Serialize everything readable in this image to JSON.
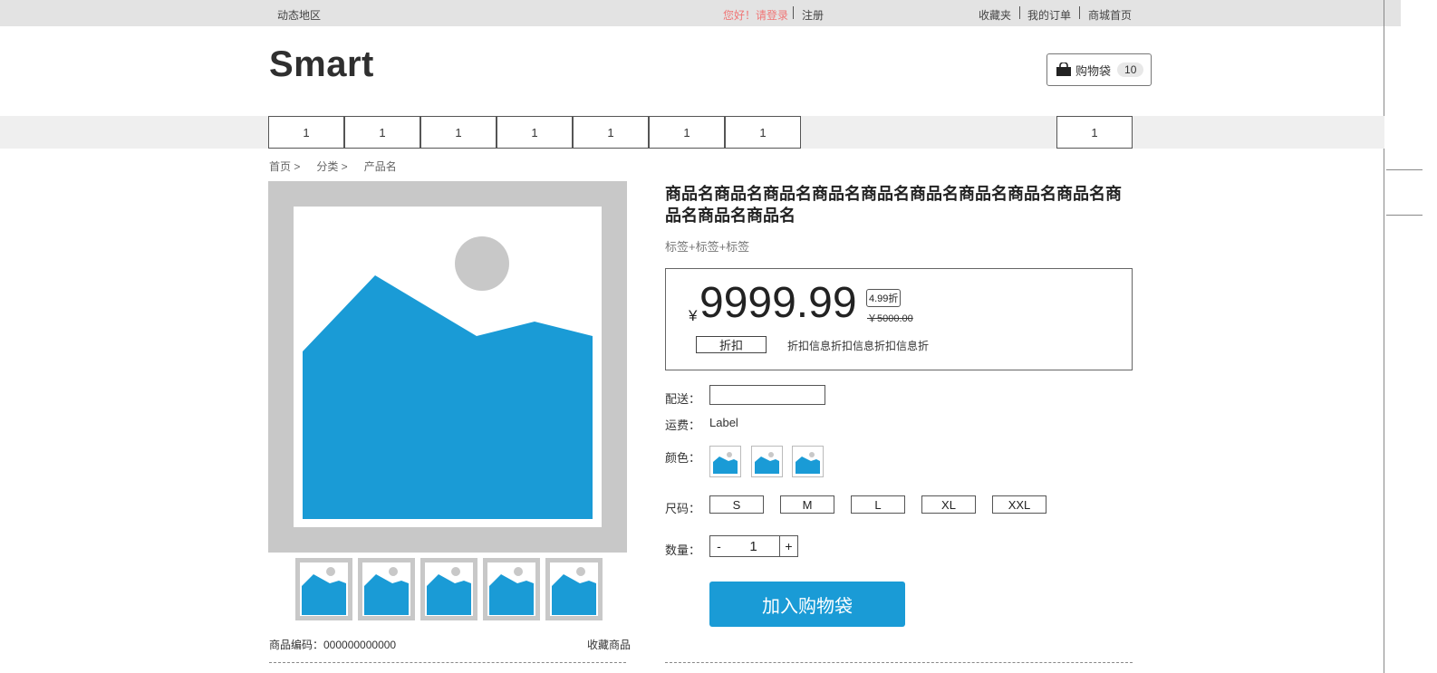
{
  "topbar": {
    "region": "动态地区",
    "greeting": "您好！请登录",
    "register": "注册",
    "favorites": "收藏夹",
    "my_orders": "我的订单",
    "mall_home": "商城首页"
  },
  "header": {
    "logo": "Smart",
    "cart_label": "购物袋",
    "cart_count": "10"
  },
  "nav": {
    "items": [
      "1",
      "1",
      "1",
      "1",
      "1",
      "1",
      "1"
    ],
    "right_item": "1"
  },
  "breadcrumb": [
    "首页 >",
    "分类 >",
    "产品名"
  ],
  "product": {
    "title": "商品名商品名商品名商品名商品名商品名商品名商品名商品名商品名商品名商品名",
    "tags": "标签+标签+标签",
    "currency": "¥",
    "price": "9999.99",
    "discount_badge": "4.99折",
    "original_price": "￥5000.00",
    "discount_label": "折扣",
    "discount_info": "折扣信息折扣信息折扣信息折",
    "sku_text": "商品编码：000000000000",
    "collect": "收藏商品"
  },
  "options": {
    "delivery_label": "配送：",
    "delivery_value": "",
    "freight_label": "运费：",
    "freight_value": "Label",
    "color_label": "颜色：",
    "size_label": "尺码：",
    "sizes": [
      "S",
      "M",
      "L",
      "XL",
      "XXL"
    ],
    "quantity_label": "数量：",
    "quantity": "1",
    "minus": "-",
    "plus": "+"
  },
  "actions": {
    "add_to_cart": "加入购物袋"
  },
  "colors": {
    "accent": "#1a9bd6",
    "image_bg": "#c8c8c8",
    "greeting": "#f07575"
  }
}
